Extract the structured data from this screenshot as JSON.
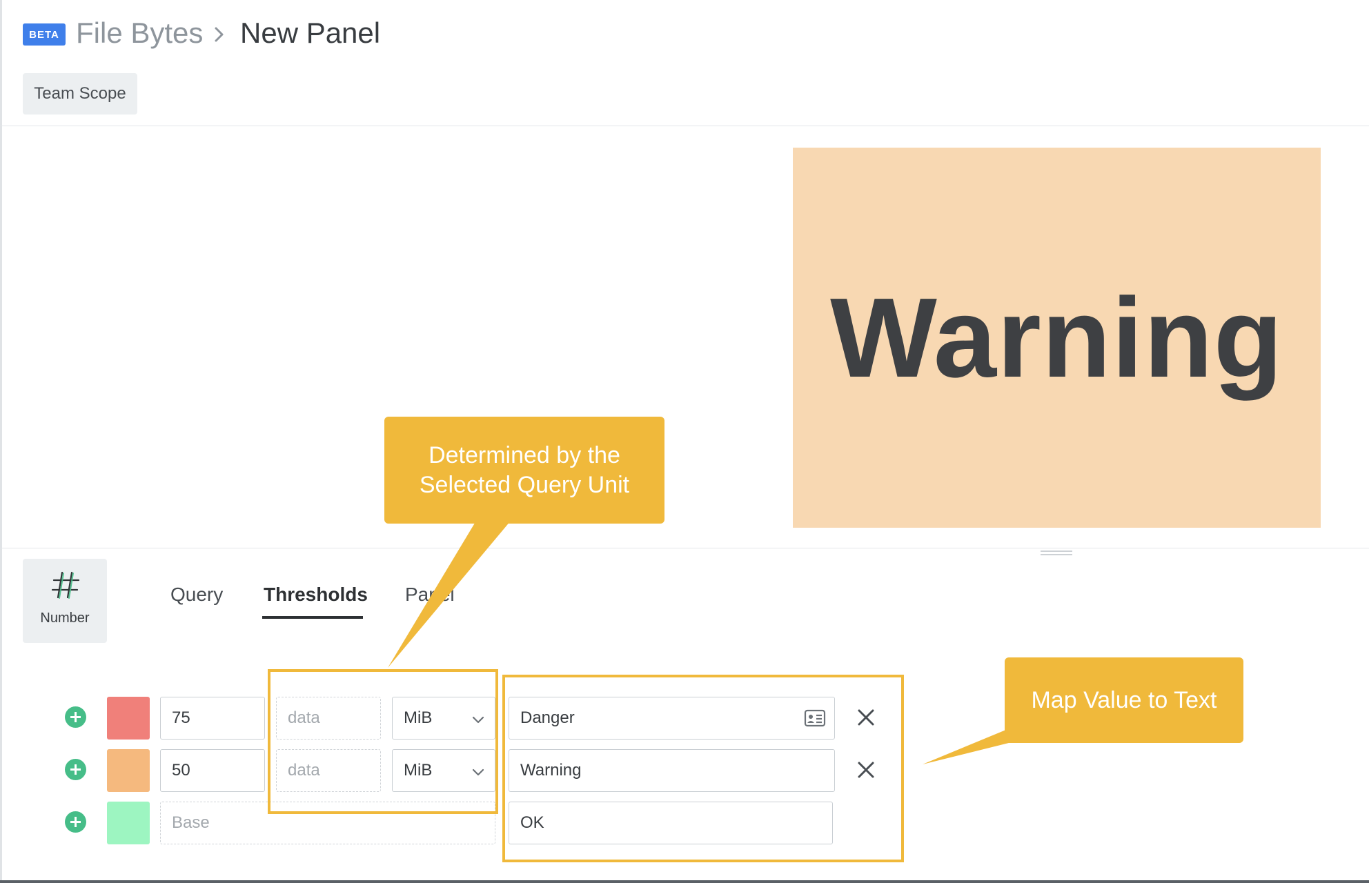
{
  "header": {
    "badge": "BETA",
    "breadcrumb_parent": "File Bytes",
    "breadcrumb_current": "New Panel",
    "scope": "Team Scope"
  },
  "preview": {
    "value_text": "Warning",
    "background_color": "#f8d8b2"
  },
  "visualization": {
    "label": "Number",
    "icon": "hash-icon"
  },
  "tabs": [
    {
      "label": "Query",
      "active": false
    },
    {
      "label": "Thresholds",
      "active": true
    },
    {
      "label": "Panel",
      "active": false
    }
  ],
  "thresholds": [
    {
      "color": "#f0807a",
      "value": "75",
      "unit_placeholder": "data",
      "unit": "MiB",
      "text": "Danger",
      "removable": true
    },
    {
      "color": "#f5b97e",
      "value": "50",
      "unit_placeholder": "data",
      "unit": "MiB",
      "text": "Warning",
      "removable": true
    },
    {
      "color": "#9df5c1",
      "value_placeholder": "Base",
      "text": "OK",
      "removable": false
    }
  ],
  "annotations": {
    "unit_callout": "Determined by the Selected Query Unit",
    "text_callout": "Map Value to Text",
    "highlight_color": "#f0b93b"
  }
}
